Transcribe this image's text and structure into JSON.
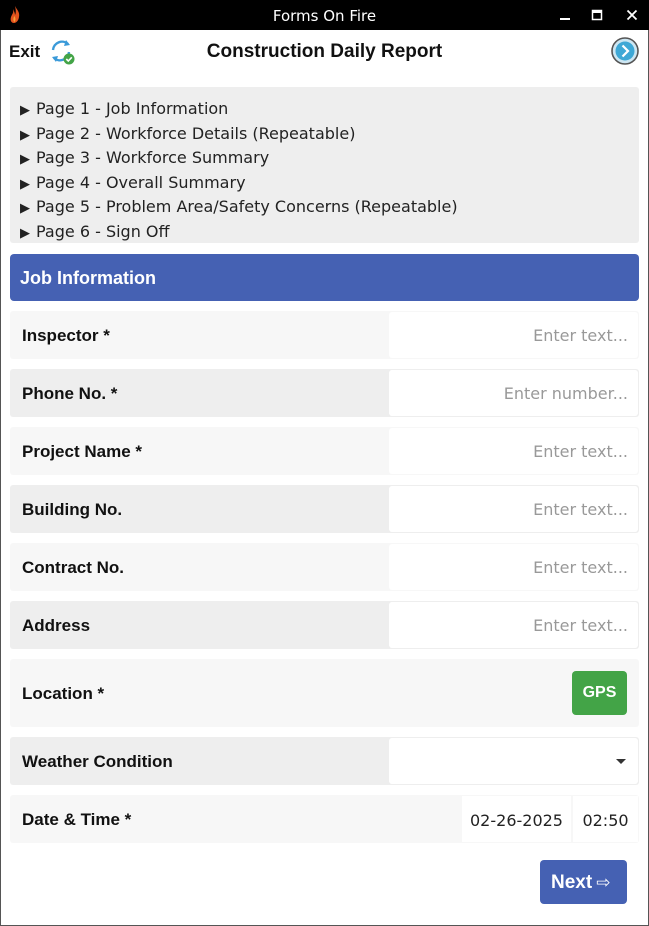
{
  "window": {
    "title": "Forms On Fire",
    "colors": {
      "titlebar": "#000000"
    }
  },
  "header": {
    "exit_label": "Exit",
    "form_title": "Construction Daily Report",
    "icons": {
      "sync": "sync-check-icon",
      "forward": "chevron-right-circle-icon"
    }
  },
  "pages": [
    {
      "label": "Page 1 - Job Information"
    },
    {
      "label": "Page 2 - Workforce Details (Repeatable)"
    },
    {
      "label": "Page 3 - Workforce Summary"
    },
    {
      "label": "Page 4 - Overall Summary"
    },
    {
      "label": "Page 5 - Problem Area/Safety Concerns (Repeatable)"
    },
    {
      "label": "Page 6 - Sign Off"
    }
  ],
  "section": {
    "title": "Job Information",
    "color": "#4561b3"
  },
  "fields": {
    "inspector": {
      "label": "Inspector *",
      "placeholder": "Enter text..."
    },
    "phone": {
      "label": "Phone No. *",
      "placeholder": "Enter number..."
    },
    "project_name": {
      "label": "Project Name *",
      "placeholder": "Enter text..."
    },
    "building_no": {
      "label": "Building No.",
      "placeholder": "Enter text..."
    },
    "contract_no": {
      "label": "Contract No.",
      "placeholder": "Enter text..."
    },
    "address": {
      "label": "Address",
      "placeholder": "Enter text..."
    },
    "location": {
      "label": "Location *",
      "button": "GPS",
      "button_color": "#43a447"
    },
    "weather": {
      "label": "Weather Condition",
      "value": ""
    },
    "datetime": {
      "label": "Date & Time *",
      "date": "02-26-2025",
      "time": "02:50"
    }
  },
  "footer": {
    "next_label": "Next",
    "next_arrow": "⇨"
  }
}
